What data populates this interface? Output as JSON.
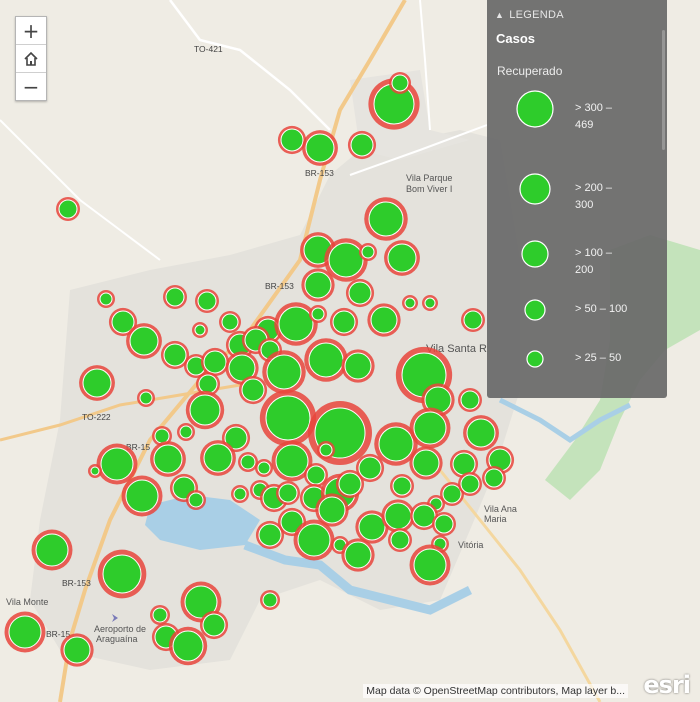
{
  "zoom": {
    "in_label": "+",
    "home_icon": "home-icon",
    "out_label": "−"
  },
  "legend": {
    "header": "LEGENDA",
    "layer_title": "Casos",
    "field_name": "Recuperado",
    "classes": [
      {
        "label": "> 300 –\n469"
      },
      {
        "label": "> 200 –\n300"
      },
      {
        "label": "> 100 –\n200"
      },
      {
        "label": "> 50 – 100"
      },
      {
        "label": "> 25 – 50"
      }
    ]
  },
  "colors": {
    "symbol_fill": "#2ecc2b",
    "symbol_halo": "#e8453c",
    "water": "#a9cfe6",
    "park": "#bfe3b5",
    "road_major": "#f2c98a",
    "urban": "#e6e4df",
    "land": "#efece4"
  },
  "map_labels": {
    "road_to421": "TO-421",
    "road_br153_a": "BR-153",
    "road_br153_b": "BR-153",
    "road_to222": "TO-222",
    "road_br153_c": "BR-15",
    "road_br153_d": "BR-153",
    "road_br153_e": "BR-15",
    "place_vila_parque": "Vila Parque",
    "place_boa_viver": "Bom Viver I",
    "place_vila_santa": "Vila Santa R",
    "place_vila_ana": "Vila Ana",
    "place_maria": "Maria",
    "place_vitoria": "Vitória",
    "place_vila_monte": "Vila Monte",
    "place_aeroporto": "Aeroporto de",
    "place_araguaina": "Araguaína"
  },
  "attribution": "Map data © OpenStreetMap contributors, Map layer b...",
  "logo": "esri"
}
